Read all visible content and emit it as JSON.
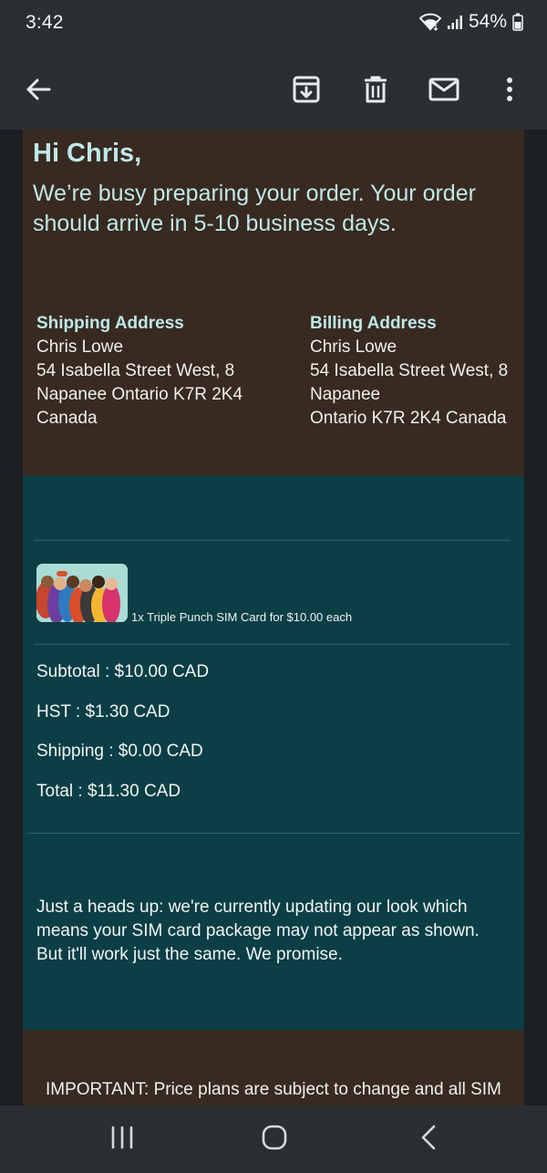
{
  "status_bar": {
    "time": "3:42",
    "battery": "54%",
    "icons": [
      "wifi-icon",
      "signal-icon",
      "battery-icon"
    ]
  },
  "toolbar": {
    "icons": [
      "back-arrow-icon",
      "archive-icon",
      "trash-icon",
      "mail-icon",
      "more-vert-icon"
    ]
  },
  "email": {
    "greeting": "Hi Chris,",
    "intro": "We’re busy preparing your order. Your order should arrive in 5-10 business days.",
    "shipping": {
      "heading": "Shipping Address",
      "lines": [
        "Chris Lowe",
        "54 Isabella Street West, 8",
        "Napanee Ontario K7R 2K4",
        "Canada"
      ]
    },
    "billing": {
      "heading": "Billing Address",
      "lines": [
        "Chris Lowe",
        "54 Isabella Street West, 8",
        "Napanee",
        "Ontario K7R 2K4 Canada"
      ]
    },
    "item": {
      "text": "1x Triple Punch SIM Card for $10.00 each"
    },
    "totals": {
      "subtotal": "Subtotal : $10.00 CAD",
      "hst": "HST : $1.30 CAD",
      "shipping": "Shipping : $0.00 CAD",
      "total": "Total : $11.30 CAD"
    },
    "note": "Just a heads up: we're currently updating our look which means your SIM card package may not appear as shown. But it'll work just the same. We promise.",
    "important": "IMPORTANT: Price plans are subject to change and all SIM"
  },
  "nav_bar": {
    "icons": [
      "recents-icon",
      "home-icon",
      "back-icon"
    ]
  },
  "colors": {
    "chrome": "#2a2f34",
    "brown_section": "#382a20",
    "teal_section": "#0b3f45",
    "heading_text": "#bfe8ea"
  }
}
